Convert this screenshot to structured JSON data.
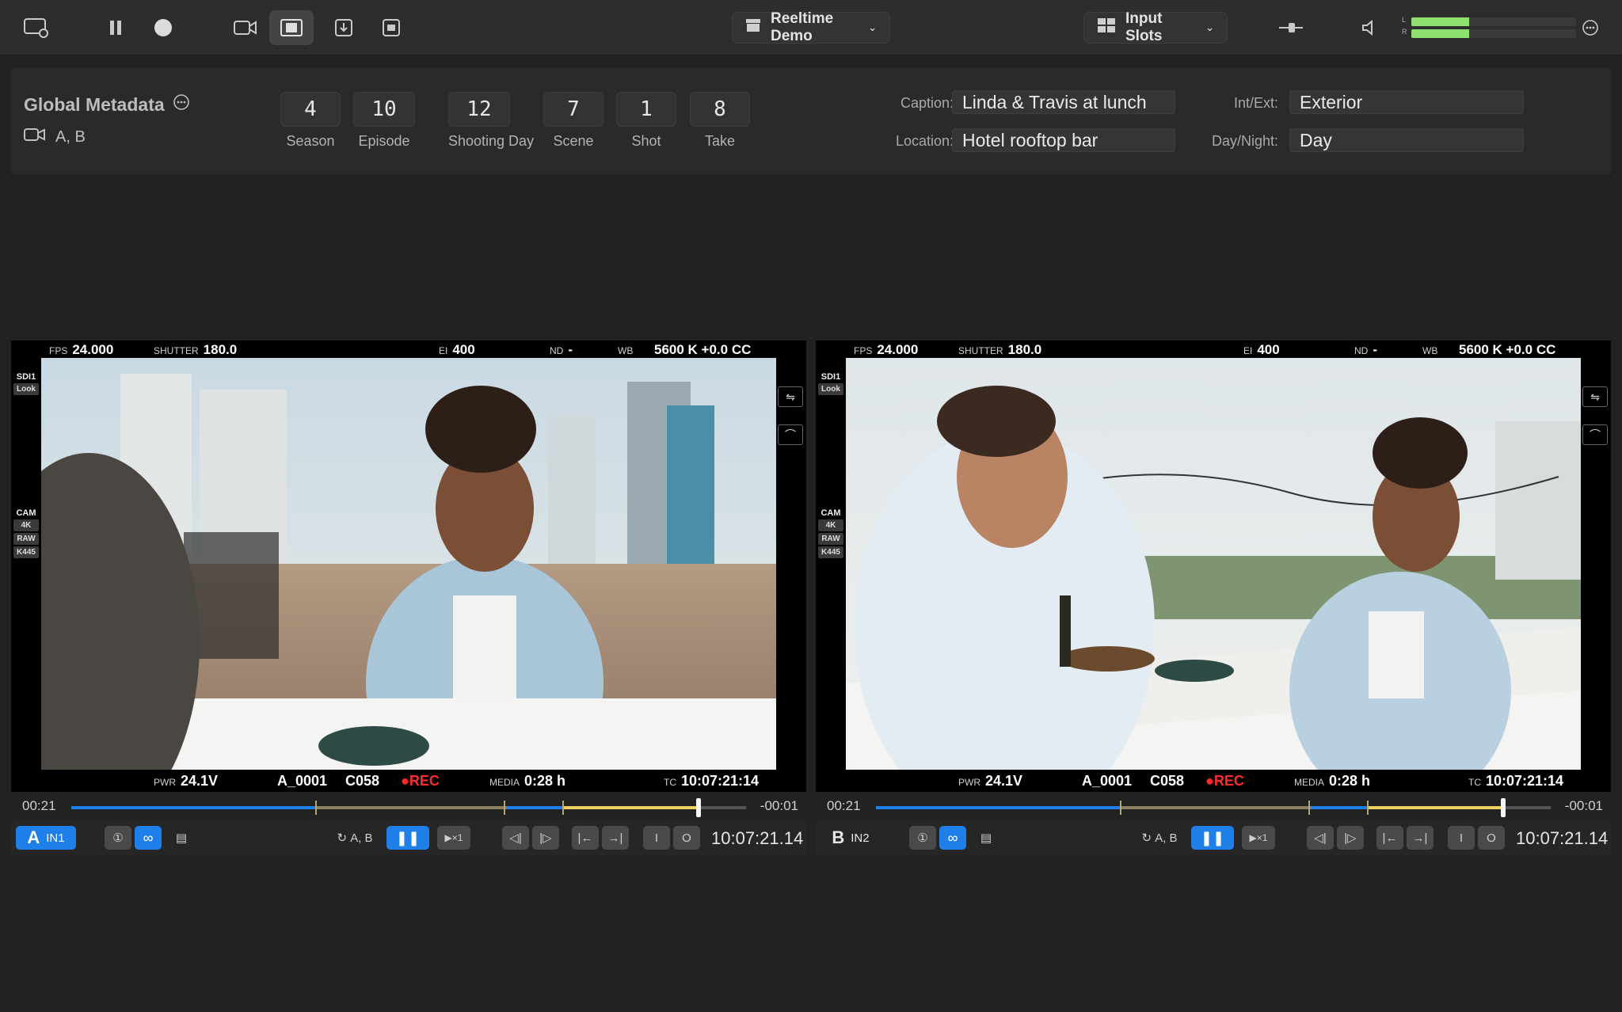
{
  "toolbar": {
    "project_label": "Reeltime Demo",
    "input_slots_label": "Input Slots",
    "meter_channels": [
      "L",
      "R"
    ],
    "meter_levels": [
      0.35,
      0.35
    ],
    "icons": [
      "monitor-settings-icon",
      "pause-icon",
      "record-icon",
      "camera-icon",
      "film-icon",
      "export-icon",
      "camera-record-icon",
      "archive-icon",
      "grid-icon",
      "scrubber-icon",
      "speaker-icon",
      "more-icon"
    ]
  },
  "metadata": {
    "title": "Global Metadata",
    "cameras": "A, B",
    "slate": [
      {
        "value": "4",
        "label": "Season"
      },
      {
        "value": "10",
        "label": "Episode"
      },
      {
        "value": "12",
        "label": "Shooting Day"
      },
      {
        "value": "7",
        "label": "Scene"
      },
      {
        "value": "1",
        "label": "Shot"
      },
      {
        "value": "8",
        "label": "Take"
      }
    ],
    "caption_label": "Caption:",
    "caption_value": "Linda & Travis at lunch",
    "location_label": "Location:",
    "location_value": "Hotel rooftop bar",
    "intext_label": "Int/Ext:",
    "intext_value": "Exterior",
    "daynight_label": "Day/Night:",
    "daynight_value": "Day"
  },
  "viewers": [
    {
      "slot": "A",
      "input": "IN1",
      "fps_label": "FPS",
      "fps": "24.000",
      "shutter_label": "SHUTTER",
      "shutter": "180.0",
      "ei_label": "EI",
      "ei": "400",
      "nd_label": "ND",
      "nd": "-",
      "wb_label": "WB",
      "wb": "5600 K +0.0 CC",
      "pwr_label": "PWR",
      "pwr": "24.1V",
      "reel": "A_0001",
      "clip": "C058",
      "rec": "REC",
      "media_label": "MEDIA",
      "media": "0:28 h",
      "tc_label": "TC",
      "tc": "10:07:21:14",
      "elapsed": "00:21",
      "remaining": "-00:01",
      "playhead_fraction": 0.93,
      "side_tags": [
        "SDI1",
        "Look",
        "CAM",
        "4K",
        "RAW",
        "K445"
      ],
      "sync_cams": "A, B",
      "speed": "×1",
      "transport_tc": "10:07:21.14"
    },
    {
      "slot": "B",
      "input": "IN2",
      "fps_label": "FPS",
      "fps": "24.000",
      "shutter_label": "SHUTTER",
      "shutter": "180.0",
      "ei_label": "EI",
      "ei": "400",
      "nd_label": "ND",
      "nd": "-",
      "wb_label": "WB",
      "wb": "5600 K +0.0 CC",
      "pwr_label": "PWR",
      "pwr": "24.1V",
      "reel": "A_0001",
      "clip": "C058",
      "rec": "REC",
      "media_label": "MEDIA",
      "media": "0:28 h",
      "tc_label": "TC",
      "tc": "10:07:21:14",
      "elapsed": "00:21",
      "remaining": "-00:01",
      "playhead_fraction": 0.93,
      "side_tags": [
        "SDI1",
        "Look",
        "CAM",
        "4K",
        "RAW",
        "K445"
      ],
      "sync_cams": "A, B",
      "speed": "×1",
      "transport_tc": "10:07:21.14"
    }
  ],
  "colors": {
    "accent": "#1f7fe8",
    "rec": "#ff2a2a",
    "timeline_blue": "#1f7fe8",
    "timeline_yellow": "#f0d060",
    "meter_green": "#8ee06f"
  }
}
